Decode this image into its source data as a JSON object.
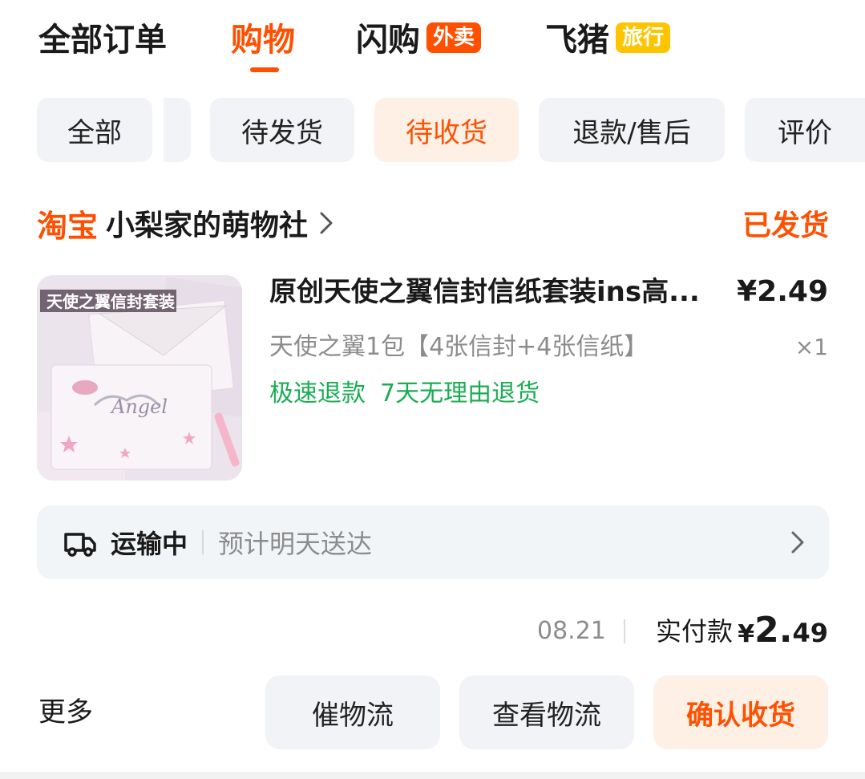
{
  "top_tabs": [
    {
      "label": "全部订单"
    },
    {
      "label": "购物",
      "active": true
    },
    {
      "label": "闪购",
      "badge": "外卖"
    },
    {
      "label": "飞猪",
      "badge": "旅行"
    }
  ],
  "filters": [
    {
      "label": "全部"
    },
    {
      "label": "待发货"
    },
    {
      "label": "待收货",
      "active": true
    },
    {
      "label": "退款/售后"
    },
    {
      "label": "评价"
    }
  ],
  "shop": {
    "platform_logo": "淘宝",
    "name": "小梨家的萌物社",
    "order_status": "已发货"
  },
  "product": {
    "image_alt": "天使之翼信封套装",
    "title": "原创天使之翼信封信纸套装ins高...",
    "price": "¥2.49",
    "sku": "天使之翼1包【4张信封+4张信纸】",
    "quantity": "×1",
    "services": [
      "极速退款",
      "7天无理由退货"
    ]
  },
  "logistics": {
    "icon": "truck-icon",
    "status": "运输中",
    "eta": "预计明天送达"
  },
  "payment": {
    "date": "08.21",
    "label": "实付款",
    "currency": "¥",
    "amount_int": "2.",
    "amount_dec": "49"
  },
  "actions": {
    "more": "更多",
    "urge": "催物流",
    "view": "查看物流",
    "confirm": "确认收货"
  },
  "colors": {
    "accent": "#ff5000",
    "service_green": "#1aad54",
    "muted": "#8c8c8c",
    "chip_bg": "#f1f3f6",
    "chip_active_bg": "#fff0e6"
  }
}
